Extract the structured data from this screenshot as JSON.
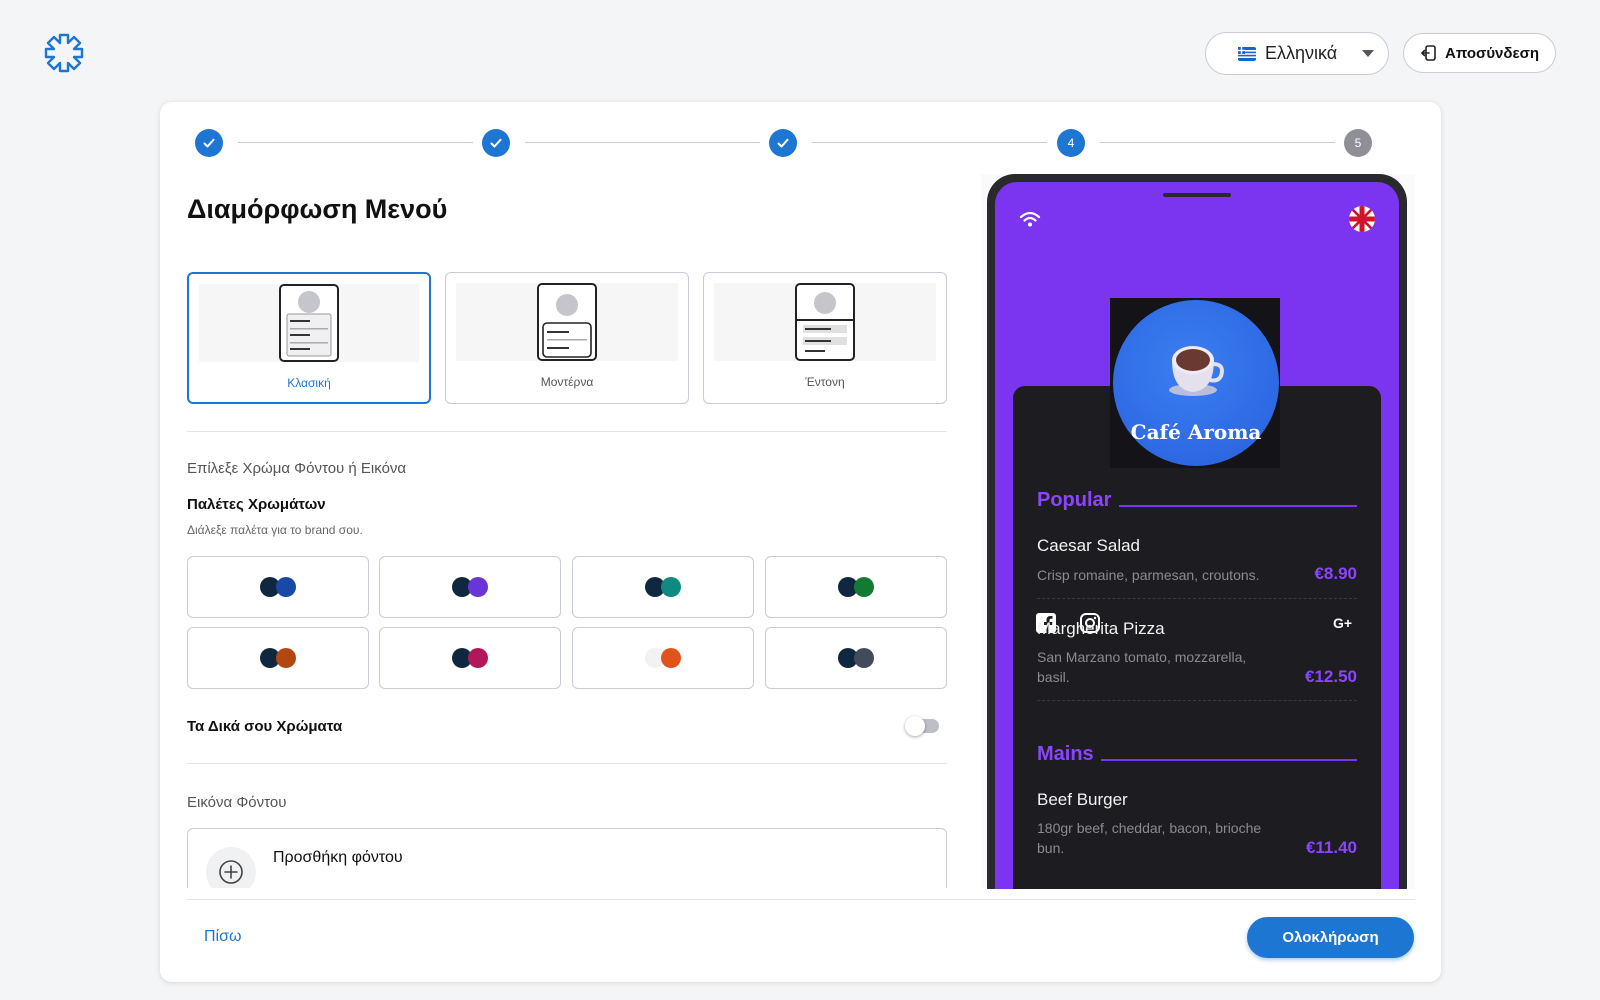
{
  "header": {
    "language": {
      "selected": "Ελληνικά",
      "flag_icon": "greece-flag-icon"
    },
    "logout_label": "Αποσύνδεση"
  },
  "stepper": {
    "steps": [
      {
        "state": "done",
        "label": ""
      },
      {
        "state": "done",
        "label": ""
      },
      {
        "state": "done",
        "label": ""
      },
      {
        "state": "active",
        "label": "4"
      },
      {
        "state": "todo",
        "label": "5"
      }
    ]
  },
  "page_title": "Διαμόρφωση Μενού",
  "templates": [
    {
      "label": "Κλασική",
      "selected": true
    },
    {
      "label": "Μοντέρνα",
      "selected": false
    },
    {
      "label": "Έντονη",
      "selected": false
    }
  ],
  "background_section": {
    "label": "Επίλεξε Χρώμα Φόντου ή Εικόνα",
    "palettes_title": "Παλέτες Χρωμάτων",
    "palettes_desc": "Διάλεξε παλέτα για το brand σου.",
    "palettes": [
      {
        "primary": "#0f2840",
        "accent": "#1849a6"
      },
      {
        "primary": "#0f2840",
        "accent": "#6a34d6"
      },
      {
        "primary": "#0f2840",
        "accent": "#0f8a83"
      },
      {
        "primary": "#0f2840",
        "accent": "#137a33"
      },
      {
        "primary": "#0f2840",
        "accent": "#b2470f"
      },
      {
        "primary": "#0f2840",
        "accent": "#b2175a"
      },
      {
        "primary": "#f2f2f2",
        "accent": "#e0541c"
      },
      {
        "primary": "#0f2840",
        "accent": "#444a5c"
      }
    ],
    "own_colors_label": "Τα Δικά σου Χρώματα",
    "own_colors_enabled": false,
    "image_label": "Εικόνα Φόντου",
    "upload_title": "Προσθήκη φόντου"
  },
  "footer": {
    "back_label": "Πίσω",
    "finish_label": "Ολοκλήρωση"
  },
  "preview": {
    "brand": "Café Aroma",
    "screen_color": "#7b35f0",
    "accent_color": "#8b45ff",
    "sections": [
      {
        "title": "Popular",
        "items": [
          {
            "name": "Caesar Salad",
            "desc": "Crisp romaine, parmesan, croutons.",
            "price": "€8.90"
          },
          {
            "name": "Margherita Pizza",
            "desc": "San Marzano tomato, mozzarella, basil.",
            "price": "€12.50"
          }
        ]
      },
      {
        "title": "Mains",
        "items": [
          {
            "name": "Beef Burger",
            "desc": "180gr beef, cheddar, bacon, brioche bun.",
            "price": "€11.40"
          }
        ]
      }
    ]
  }
}
